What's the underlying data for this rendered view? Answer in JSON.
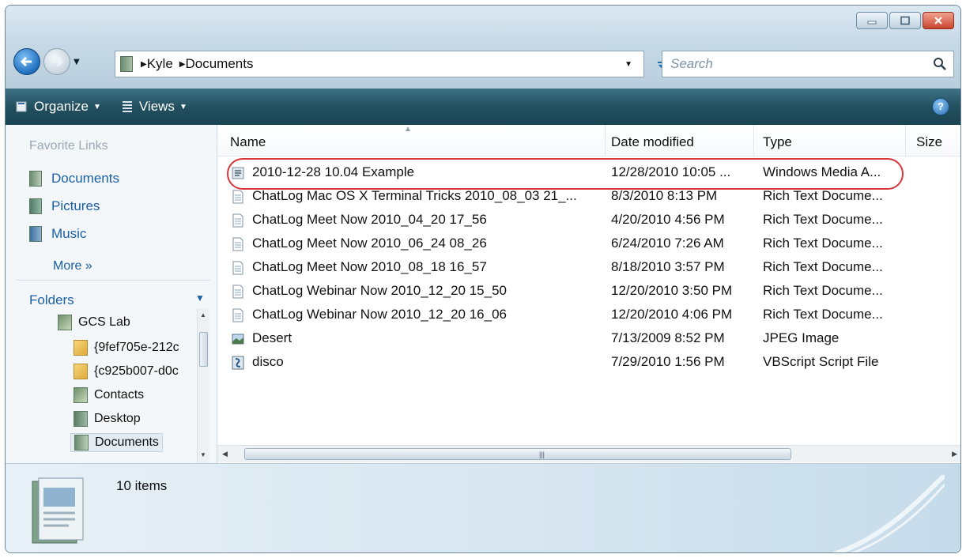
{
  "address": {
    "crumbs": [
      "Kyle",
      "Documents"
    ]
  },
  "search": {
    "placeholder": "Search"
  },
  "toolbar": {
    "organize": "Organize",
    "views": "Views"
  },
  "sidebar": {
    "favorites_title": "Favorite Links",
    "favorites": [
      {
        "label": "Documents",
        "icon": "documents-icon"
      },
      {
        "label": "Pictures",
        "icon": "pictures-icon"
      },
      {
        "label": "Music",
        "icon": "music-icon"
      }
    ],
    "more_label": "More",
    "folders_label": "Folders",
    "tree": [
      {
        "label": "GCS Lab",
        "level": 1
      },
      {
        "label": "{9fef705e-212c",
        "level": 2
      },
      {
        "label": "{c925b007-d0c",
        "level": 2
      },
      {
        "label": "Contacts",
        "level": 2
      },
      {
        "label": "Desktop",
        "level": 2
      },
      {
        "label": "Documents",
        "level": 2,
        "selected": true
      }
    ]
  },
  "columns": {
    "name": "Name",
    "date": "Date modified",
    "type": "Type",
    "size": "Size"
  },
  "files": [
    {
      "name": "2010-12-28 10.04 Example",
      "date": "12/28/2010 10:05 ...",
      "type": "Windows Media A...",
      "icon": "media-file-icon"
    },
    {
      "name": "ChatLog Mac OS X Terminal Tricks 2010_08_03 21_...",
      "date": "8/3/2010 8:13 PM",
      "type": "Rich Text Docume...",
      "icon": "rtf-file-icon"
    },
    {
      "name": "ChatLog Meet Now 2010_04_20 17_56",
      "date": "4/20/2010 4:56 PM",
      "type": "Rich Text Docume...",
      "icon": "rtf-file-icon"
    },
    {
      "name": "ChatLog Meet Now 2010_06_24 08_26",
      "date": "6/24/2010 7:26 AM",
      "type": "Rich Text Docume...",
      "icon": "rtf-file-icon"
    },
    {
      "name": "ChatLog Meet Now 2010_08_18 16_57",
      "date": "8/18/2010 3:57 PM",
      "type": "Rich Text Docume...",
      "icon": "rtf-file-icon"
    },
    {
      "name": "ChatLog Webinar Now 2010_12_20 15_50",
      "date": "12/20/2010 3:50 PM",
      "type": "Rich Text Docume...",
      "icon": "rtf-file-icon"
    },
    {
      "name": "ChatLog Webinar Now 2010_12_20 16_06",
      "date": "12/20/2010 4:06 PM",
      "type": "Rich Text Docume...",
      "icon": "rtf-file-icon"
    },
    {
      "name": "Desert",
      "date": "7/13/2009 8:52 PM",
      "type": "JPEG Image",
      "icon": "jpeg-file-icon"
    },
    {
      "name": "disco",
      "date": "7/29/2010 1:56 PM",
      "type": "VBScript Script File",
      "icon": "vbscript-file-icon"
    }
  ],
  "status": {
    "count": "10 items"
  },
  "colors": {
    "highlight": "#d7363a",
    "toolbar": "#22505f",
    "link": "#1a5fa4"
  }
}
